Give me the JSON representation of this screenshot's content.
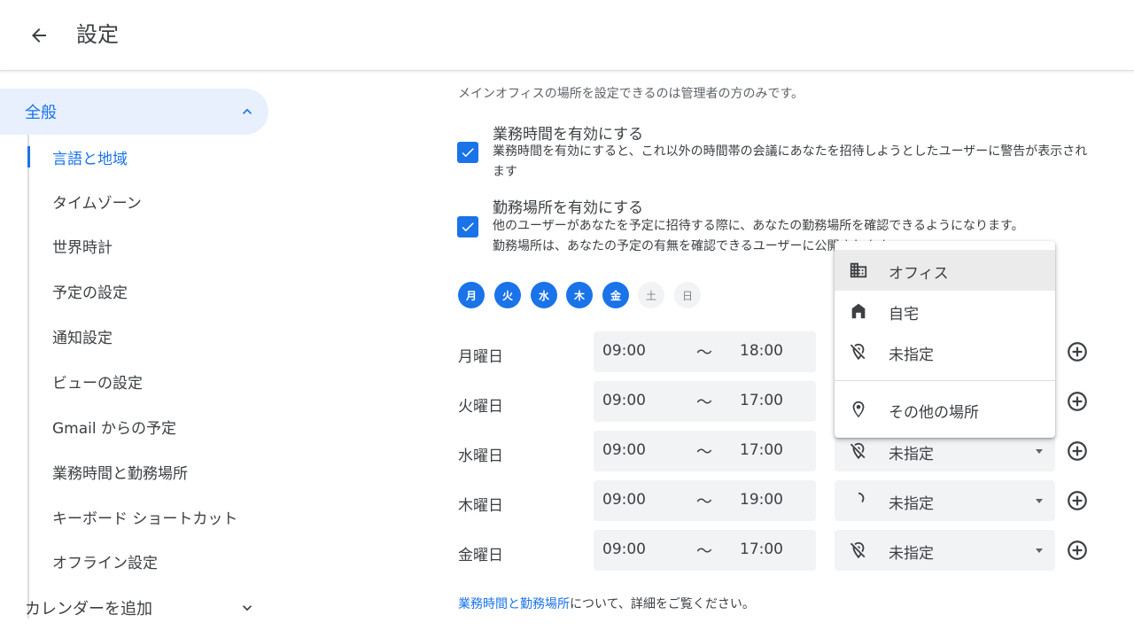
{
  "header": {
    "title": "設定"
  },
  "sidebar": {
    "general": "全般",
    "items": [
      {
        "label": "言語と地域",
        "active": true
      },
      {
        "label": "タイムゾーン"
      },
      {
        "label": "世界時計"
      },
      {
        "label": "予定の設定"
      },
      {
        "label": "通知設定"
      },
      {
        "label": "ビューの設定"
      },
      {
        "label": "Gmail からの予定"
      },
      {
        "label": "業務時間と勤務場所"
      },
      {
        "label": "キーボード ショートカット"
      },
      {
        "label": "オフライン設定"
      }
    ],
    "add_calendar": "カレンダーを追加"
  },
  "main": {
    "note": "メインオフィスの場所を設定できるのは管理者の方のみです。",
    "working_hours": {
      "title": "業務時間を有効にする",
      "desc1": "業務時間を有効にすると、これ以外の時間帯の会議にあなたを招待しようとしたユーザーに警告が表示され",
      "desc2": "ます",
      "checked": true
    },
    "working_location": {
      "title": "勤務場所を有効にする",
      "desc1": "他のユーザーがあなたを予定に招待する際に、あなたの勤務場所を確認できるようになります。",
      "desc2": "勤務場所は、あなたの予定の有無を確認できるユーザーに公開されます。",
      "checked": true
    },
    "days": [
      {
        "label": "月",
        "on": true
      },
      {
        "label": "火",
        "on": true
      },
      {
        "label": "水",
        "on": true
      },
      {
        "label": "木",
        "on": true
      },
      {
        "label": "金",
        "on": true
      },
      {
        "label": "土",
        "on": false
      },
      {
        "label": "日",
        "on": false
      }
    ],
    "tilde": "〜",
    "rows": [
      {
        "day": "月曜日",
        "start": "09:00",
        "end": "18:00",
        "location": ""
      },
      {
        "day": "火曜日",
        "start": "09:00",
        "end": "17:00",
        "location": ""
      },
      {
        "day": "水曜日",
        "start": "09:00",
        "end": "17:00",
        "location": "未指定"
      },
      {
        "day": "木曜日",
        "start": "09:00",
        "end": "19:00",
        "location": "未指定"
      },
      {
        "day": "金曜日",
        "start": "09:00",
        "end": "17:00",
        "location": "未指定"
      }
    ],
    "footer_link": "業務時間と勤務場所",
    "footer_text": "について、詳細をご覧ください。"
  },
  "menu": {
    "items": [
      {
        "label": "オフィス",
        "icon": "building-icon",
        "hover": true
      },
      {
        "label": "自宅",
        "icon": "home-icon"
      },
      {
        "label": "未指定",
        "icon": "location-off-icon"
      },
      {
        "label": "その他の場所",
        "icon": "location-pin-icon"
      }
    ]
  },
  "colors": {
    "accent": "#1a73e8",
    "nav_active_bg": "#e8f0fe",
    "field_bg": "#f1f3f4"
  }
}
